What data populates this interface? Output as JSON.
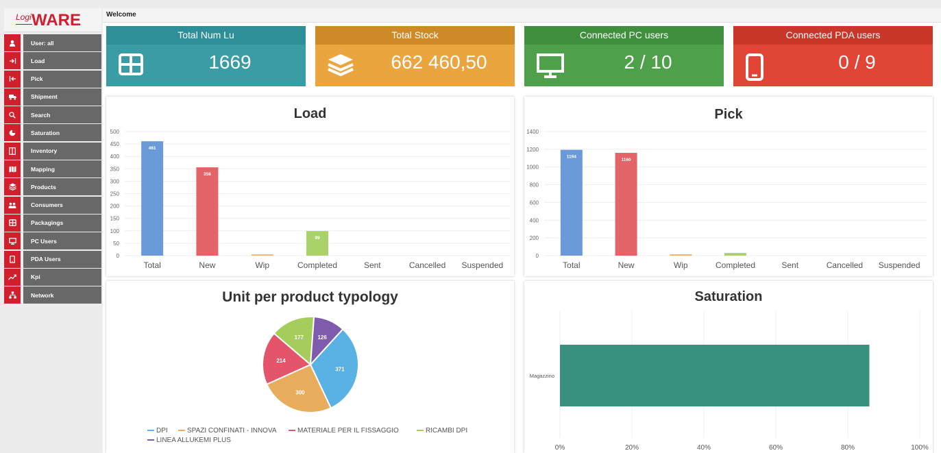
{
  "logo": {
    "prefix": "Logi",
    "name": "WARE"
  },
  "topbar": {
    "title": "Welcome"
  },
  "menu": [
    {
      "label": "User: all",
      "icon": "user-icon"
    },
    {
      "label": "Load",
      "icon": "load-arrow-icon"
    },
    {
      "label": "Pick",
      "icon": "pick-arrow-icon"
    },
    {
      "label": "Shipment",
      "icon": "truck-icon"
    },
    {
      "label": "Search",
      "icon": "search-icon"
    },
    {
      "label": "Saturation",
      "icon": "pie-icon"
    },
    {
      "label": "Inventory",
      "icon": "inventory-icon"
    },
    {
      "label": "Mapping",
      "icon": "map-icon"
    },
    {
      "label": "Products",
      "icon": "layers-icon"
    },
    {
      "label": "Consumers",
      "icon": "users-icon"
    },
    {
      "label": "Packagings",
      "icon": "grid-icon"
    },
    {
      "label": "PC Users",
      "icon": "monitor-icon"
    },
    {
      "label": "PDA Users",
      "icon": "mobile-icon"
    },
    {
      "label": "Kpi",
      "icon": "trend-icon"
    },
    {
      "label": "Network",
      "icon": "network-icon"
    }
  ],
  "kpis": [
    {
      "title": "Total Num Lu",
      "value": "1669",
      "icon": "grid-icon",
      "head_color": "#2f8f98",
      "body_color": "#3a9da6"
    },
    {
      "title": "Total Stock",
      "value": "662 460,50",
      "icon": "layers-icon",
      "head_color": "#cf8a28",
      "body_color": "#eba53f"
    },
    {
      "title": "Connected PC users",
      "value": "2 / 10",
      "icon": "monitor-icon",
      "head_color": "#3f8f3d",
      "body_color": "#4ea14a"
    },
    {
      "title": "Connected PDA users",
      "value": "0 / 9",
      "icon": "mobile-icon",
      "head_color": "#c9372a",
      "body_color": "#e04535"
    }
  ],
  "chart_data": [
    {
      "type": "bar",
      "title": "Load",
      "categories": [
        "Total",
        "New",
        "Wip",
        "Completed",
        "Sent",
        "Cancelled",
        "Suspended"
      ],
      "values": [
        461,
        356,
        5,
        99,
        0,
        0,
        0
      ],
      "data_labels": [
        "461",
        "356",
        "",
        "99",
        "",
        "",
        ""
      ],
      "colors": [
        "#6a9bd8",
        "#e26469",
        "#f0b36a",
        "#a9d36a",
        "#6a9bd8",
        "#6a9bd8",
        "#6a9bd8"
      ],
      "ylim": [
        0,
        500
      ],
      "yticks": [
        0,
        50,
        100,
        150,
        200,
        250,
        300,
        350,
        400,
        450,
        500
      ],
      "grid": true
    },
    {
      "type": "bar",
      "title": "Pick",
      "categories": [
        "Total",
        "New",
        "Wip",
        "Completed",
        "Sent",
        "Cancelled",
        "Suspended"
      ],
      "values": [
        1194,
        1160,
        15,
        30,
        0,
        0,
        0
      ],
      "data_labels": [
        "1194",
        "1160",
        "",
        "",
        "",
        "",
        ""
      ],
      "colors": [
        "#6a9bd8",
        "#e26469",
        "#f0b36a",
        "#a9d36a",
        "#6a9bd8",
        "#6a9bd8",
        "#6a9bd8"
      ],
      "ylim": [
        0,
        1400
      ],
      "yticks": [
        0,
        200,
        400,
        600,
        800,
        1000,
        1200,
        1400
      ],
      "grid": true
    },
    {
      "type": "pie",
      "title": "Unit per product typology",
      "labels": [
        "DPI",
        "SPAZI CONFINATI - INNOVA",
        "MATERIALE PER IL FISSAGGIO",
        "RICAMBI DPI",
        "LINEA ALLUKEMI PLUS"
      ],
      "values": [
        371,
        300,
        214,
        177,
        126
      ],
      "colors": [
        "#59b1e4",
        "#e8ad5c",
        "#e4546a",
        "#a6cd5b",
        "#7e5bac"
      ],
      "legend": "bottom"
    },
    {
      "type": "bar",
      "orientation": "horizontal",
      "title": "Saturation",
      "categories": [
        "Magazzino"
      ],
      "values": [
        86
      ],
      "colors": [
        "#39907e"
      ],
      "xlim": [
        0,
        100
      ],
      "xticks": [
        "0%",
        "20%",
        "40%",
        "60%",
        "80%",
        "100%"
      ],
      "grid": true
    }
  ]
}
